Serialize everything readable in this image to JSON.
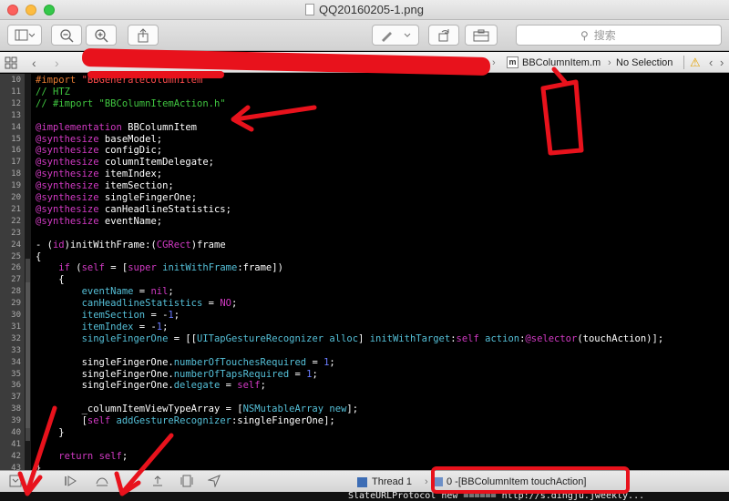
{
  "window": {
    "title": "QQ20160205-1.png"
  },
  "toolbar": {
    "search_placeholder": "搜索"
  },
  "jumpbar": {
    "file": "BBColumnItem.m",
    "selection": "No Selection"
  },
  "code_lines": [
    {
      "num": "10",
      "segments": [
        {
          "cls": "p",
          "text": "#import "
        },
        {
          "cls": "s",
          "text": "\"BBGeneratecolumnItem\""
        }
      ]
    },
    {
      "num": "11",
      "segments": [
        {
          "cls": "c",
          "text": "// HTZ"
        }
      ]
    },
    {
      "num": "12",
      "segments": [
        {
          "cls": "c",
          "text": "// #import \"BBColumnItemAction.h\""
        }
      ]
    },
    {
      "num": "13",
      "segments": []
    },
    {
      "num": "14",
      "segments": [
        {
          "cls": "k",
          "text": "@implementation"
        },
        {
          "cls": "pl",
          "text": " BBColumnItem"
        }
      ]
    },
    {
      "num": "15",
      "segments": [
        {
          "cls": "k",
          "text": "@synthesize"
        },
        {
          "cls": "pl",
          "text": " baseModel;"
        }
      ]
    },
    {
      "num": "16",
      "segments": [
        {
          "cls": "k",
          "text": "@synthesize"
        },
        {
          "cls": "pl",
          "text": " configDic;"
        }
      ]
    },
    {
      "num": "17",
      "segments": [
        {
          "cls": "k",
          "text": "@synthesize"
        },
        {
          "cls": "pl",
          "text": " columnItemDelegate;"
        }
      ]
    },
    {
      "num": "18",
      "segments": [
        {
          "cls": "k",
          "text": "@synthesize"
        },
        {
          "cls": "pl",
          "text": " itemIndex;"
        }
      ]
    },
    {
      "num": "19",
      "segments": [
        {
          "cls": "k",
          "text": "@synthesize"
        },
        {
          "cls": "pl",
          "text": " itemSection;"
        }
      ]
    },
    {
      "num": "20",
      "segments": [
        {
          "cls": "k",
          "text": "@synthesize"
        },
        {
          "cls": "pl",
          "text": " singleFingerOne;"
        }
      ]
    },
    {
      "num": "21",
      "segments": [
        {
          "cls": "k",
          "text": "@synthesize"
        },
        {
          "cls": "pl",
          "text": " canHeadlineStatistics;"
        }
      ]
    },
    {
      "num": "22",
      "segments": [
        {
          "cls": "k",
          "text": "@synthesize"
        },
        {
          "cls": "pl",
          "text": " eventName;"
        }
      ]
    },
    {
      "num": "23",
      "segments": []
    },
    {
      "num": "24",
      "segments": [
        {
          "cls": "pl",
          "text": "- ("
        },
        {
          "cls": "k",
          "text": "id"
        },
        {
          "cls": "pl",
          "text": ")initWithFrame:("
        },
        {
          "cls": "k",
          "text": "CGRect"
        },
        {
          "cls": "pl",
          "text": ")frame"
        }
      ]
    },
    {
      "num": "25",
      "segments": [
        {
          "cls": "pl",
          "text": "{"
        }
      ]
    },
    {
      "num": "26",
      "segments": [
        {
          "cls": "pl",
          "text": "    "
        },
        {
          "cls": "k",
          "text": "if"
        },
        {
          "cls": "pl",
          "text": " ("
        },
        {
          "cls": "k",
          "text": "self"
        },
        {
          "cls": "pl",
          "text": " = ["
        },
        {
          "cls": "k",
          "text": "super"
        },
        {
          "cls": "pl",
          "text": " "
        },
        {
          "cls": "t",
          "text": "initWithFrame"
        },
        {
          "cls": "pl",
          "text": ":frame])"
        }
      ]
    },
    {
      "num": "27",
      "segments": [
        {
          "cls": "pl",
          "text": "    {"
        }
      ]
    },
    {
      "num": "28",
      "segments": [
        {
          "cls": "pl",
          "text": "        "
        },
        {
          "cls": "t",
          "text": "eventName"
        },
        {
          "cls": "pl",
          "text": " = "
        },
        {
          "cls": "k",
          "text": "nil"
        },
        {
          "cls": "pl",
          "text": ";"
        }
      ]
    },
    {
      "num": "29",
      "segments": [
        {
          "cls": "pl",
          "text": "        "
        },
        {
          "cls": "t",
          "text": "canHeadlineStatistics"
        },
        {
          "cls": "pl",
          "text": " = "
        },
        {
          "cls": "k",
          "text": "NO"
        },
        {
          "cls": "pl",
          "text": ";"
        }
      ]
    },
    {
      "num": "30",
      "segments": [
        {
          "cls": "pl",
          "text": "        "
        },
        {
          "cls": "t",
          "text": "itemSection"
        },
        {
          "cls": "pl",
          "text": " = -"
        },
        {
          "cls": "n",
          "text": "1"
        },
        {
          "cls": "pl",
          "text": ";"
        }
      ]
    },
    {
      "num": "31",
      "segments": [
        {
          "cls": "pl",
          "text": "        "
        },
        {
          "cls": "t",
          "text": "itemIndex"
        },
        {
          "cls": "pl",
          "text": " = -"
        },
        {
          "cls": "n",
          "text": "1"
        },
        {
          "cls": "pl",
          "text": ";"
        }
      ]
    },
    {
      "num": "32",
      "segments": [
        {
          "cls": "pl",
          "text": "        "
        },
        {
          "cls": "t",
          "text": "singleFingerOne"
        },
        {
          "cls": "pl",
          "text": " = [["
        },
        {
          "cls": "t",
          "text": "UITapGestureRecognizer"
        },
        {
          "cls": "pl",
          "text": " "
        },
        {
          "cls": "t",
          "text": "alloc"
        },
        {
          "cls": "pl",
          "text": "] "
        },
        {
          "cls": "t",
          "text": "initWithTarget"
        },
        {
          "cls": "pl",
          "text": ":"
        },
        {
          "cls": "k",
          "text": "self"
        },
        {
          "cls": "pl",
          "text": " "
        },
        {
          "cls": "t",
          "text": "action"
        },
        {
          "cls": "pl",
          "text": ":"
        },
        {
          "cls": "k",
          "text": "@selector"
        },
        {
          "cls": "pl",
          "text": "(touchAction)];"
        }
      ]
    },
    {
      "num": "33",
      "segments": []
    },
    {
      "num": "34",
      "segments": [
        {
          "cls": "pl",
          "text": "        singleFingerOne."
        },
        {
          "cls": "t",
          "text": "numberOfTouchesRequired"
        },
        {
          "cls": "pl",
          "text": " = "
        },
        {
          "cls": "n",
          "text": "1"
        },
        {
          "cls": "pl",
          "text": ";"
        }
      ]
    },
    {
      "num": "35",
      "segments": [
        {
          "cls": "pl",
          "text": "        singleFingerOne."
        },
        {
          "cls": "t",
          "text": "numberOfTapsRequired"
        },
        {
          "cls": "pl",
          "text": " = "
        },
        {
          "cls": "n",
          "text": "1"
        },
        {
          "cls": "pl",
          "text": ";"
        }
      ]
    },
    {
      "num": "36",
      "segments": [
        {
          "cls": "pl",
          "text": "        singleFingerOne."
        },
        {
          "cls": "t",
          "text": "delegate"
        },
        {
          "cls": "pl",
          "text": " = "
        },
        {
          "cls": "k",
          "text": "self"
        },
        {
          "cls": "pl",
          "text": ";"
        }
      ]
    },
    {
      "num": "37",
      "segments": []
    },
    {
      "num": "38",
      "segments": [
        {
          "cls": "pl",
          "text": "        _columnItemViewTypeArray = ["
        },
        {
          "cls": "t",
          "text": "NSMutableArray"
        },
        {
          "cls": "pl",
          "text": " "
        },
        {
          "cls": "t",
          "text": "new"
        },
        {
          "cls": "pl",
          "text": "];"
        }
      ]
    },
    {
      "num": "39",
      "segments": [
        {
          "cls": "pl",
          "text": "        ["
        },
        {
          "cls": "k",
          "text": "self"
        },
        {
          "cls": "pl",
          "text": " "
        },
        {
          "cls": "t",
          "text": "addGestureRecognizer"
        },
        {
          "cls": "pl",
          "text": ":singleFingerOne];"
        }
      ]
    },
    {
      "num": "40",
      "segments": [
        {
          "cls": "pl",
          "text": "    }"
        }
      ]
    },
    {
      "num": "41",
      "segments": []
    },
    {
      "num": "42",
      "segments": [
        {
          "cls": "pl",
          "text": "    "
        },
        {
          "cls": "k",
          "text": "return"
        },
        {
          "cls": "pl",
          "text": " "
        },
        {
          "cls": "k",
          "text": "self"
        },
        {
          "cls": "pl",
          "text": ";"
        }
      ]
    },
    {
      "num": "43",
      "segments": [
        {
          "cls": "pl",
          "text": "}"
        }
      ]
    }
  ],
  "debugbar": {
    "thread": "Thread 1",
    "frame": "0 -[BBColumnItem touchAction]"
  },
  "console": {
    "text": "SlateURLProtocol new ====== http://s.dingju.jweekly..."
  },
  "colors": {
    "annotation_red": "#e8121c",
    "keyword": "#d23ac4",
    "comment": "#40c640"
  }
}
